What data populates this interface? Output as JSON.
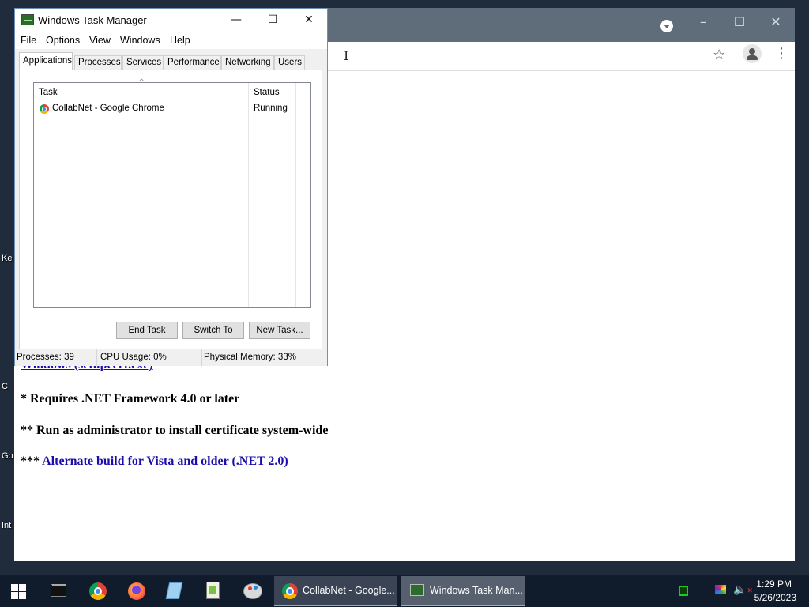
{
  "desktop": {
    "label_fragments": [
      "Ke",
      "C",
      "Go",
      "Int"
    ]
  },
  "chrome": {
    "window_controls": {
      "minimize": "–",
      "maximize": "☐",
      "close": "✕"
    },
    "page": {
      "partial_link": "Windows (setupcert.exe)",
      "partial_suffix": "** ***",
      "note1": "* Requires .NET Framework 4.0 or later",
      "note2": "** Run as administrator to install certificate system-wide",
      "note3_prefix": "***",
      "note3_link": "Alternate build for Vista and older (.NET 2.0)"
    }
  },
  "taskmgr": {
    "title": "Windows Task Manager",
    "controls": {
      "minimize": "—",
      "maximize": "☐",
      "close": "✕"
    },
    "menu": [
      "File",
      "Options",
      "View",
      "Windows",
      "Help"
    ],
    "tabs": [
      "Applications",
      "Processes",
      "Services",
      "Performance",
      "Networking",
      "Users"
    ],
    "active_tab": "Applications",
    "columns": {
      "task": "Task",
      "status": "Status"
    },
    "tasks": [
      {
        "name": "CollabNet - Google Chrome",
        "status": "Running",
        "icon": "chrome-icon"
      }
    ],
    "buttons": {
      "end_task": "End Task",
      "switch_to": "Switch To",
      "new_task": "New Task..."
    },
    "status_bar": {
      "processes": "Processes: 39",
      "cpu": "CPU Usage: 0%",
      "memory": "Physical Memory: 33%"
    }
  },
  "taskbar": {
    "pinned": [
      "command-prompt-icon",
      "chrome-icon",
      "firefox-icon",
      "notepad-icon",
      "notepad-plus-plus-icon",
      "paint-icon"
    ],
    "tasks": [
      {
        "label": "CollabNet - Google...",
        "icon": "chrome-icon",
        "active": false
      },
      {
        "label": "Windows Task Man...",
        "icon": "task-manager-icon",
        "active": true
      }
    ],
    "clock": {
      "time": "1:29 PM",
      "date": "5/26/2023"
    },
    "tray_icons": [
      "task-manager-tray-icon",
      "display-icon",
      "volume-muted-icon"
    ]
  }
}
